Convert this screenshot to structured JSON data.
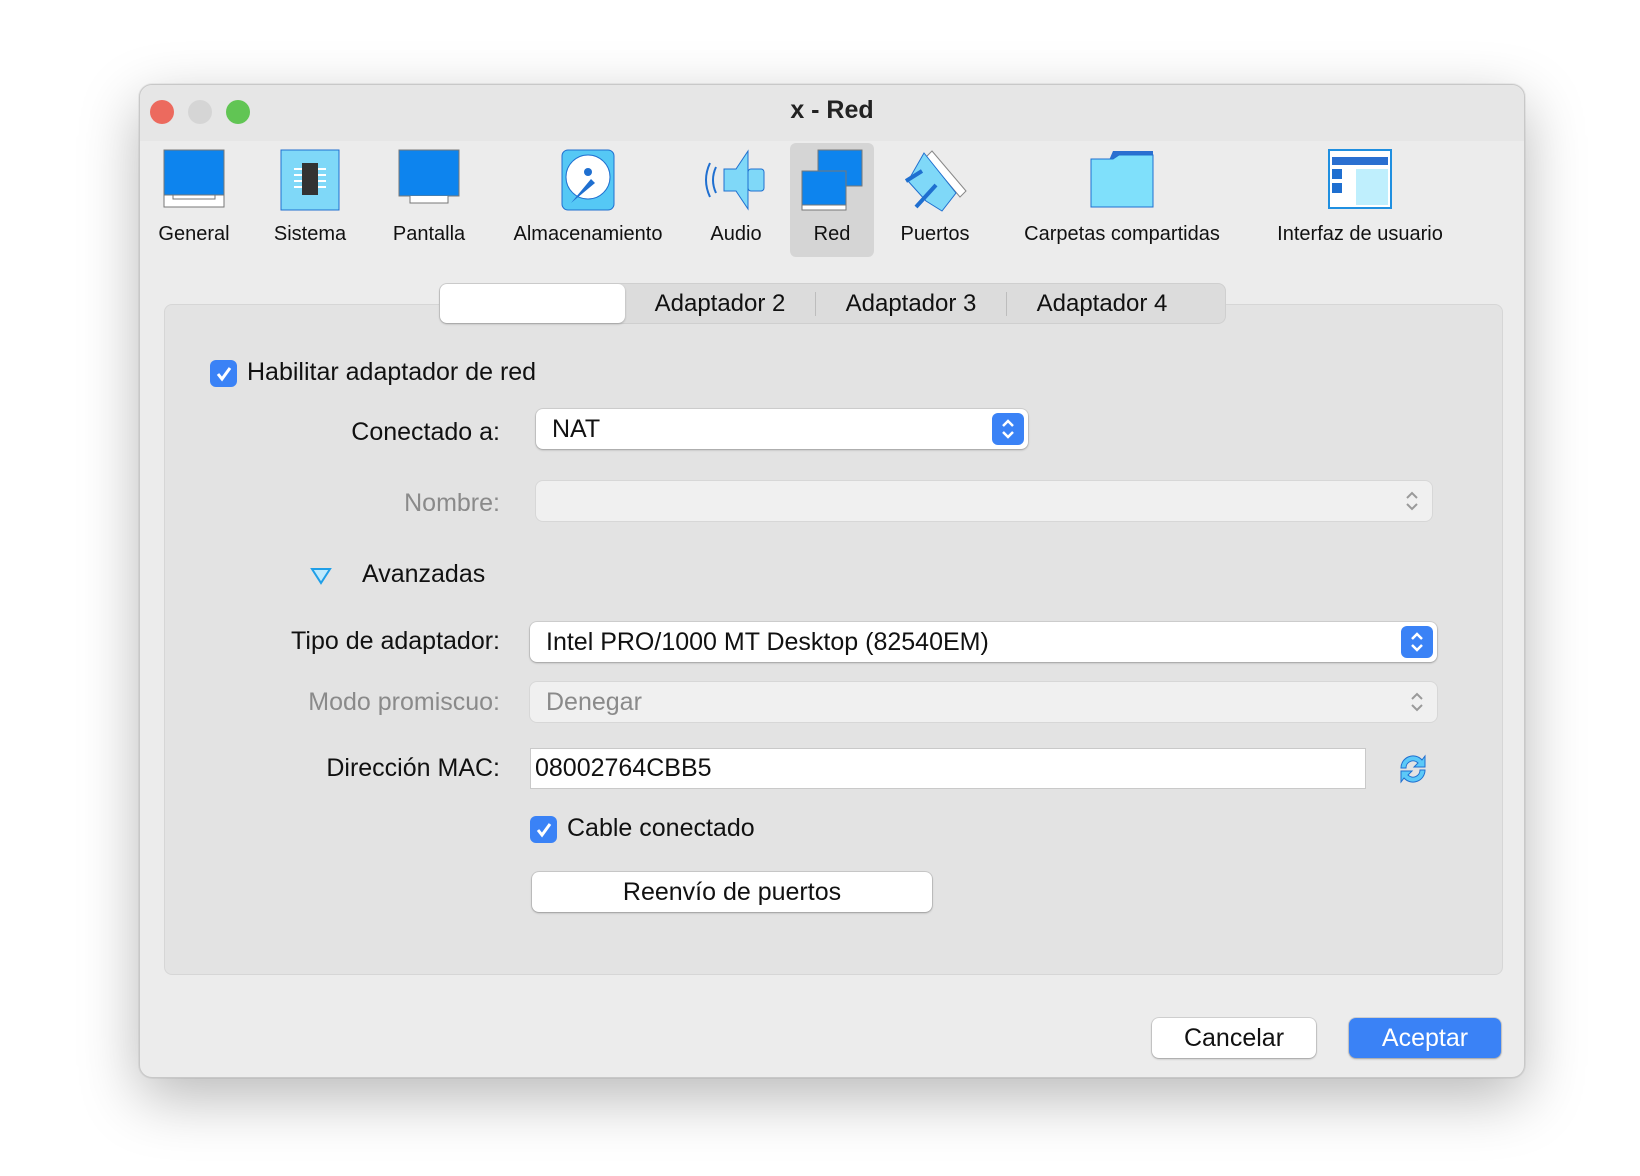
{
  "window": {
    "title": "x - Red"
  },
  "toolbar": {
    "items": [
      {
        "label": "General",
        "icon": "monitor-icon"
      },
      {
        "label": "Sistema",
        "icon": "chip-icon"
      },
      {
        "label": "Pantalla",
        "icon": "display-icon"
      },
      {
        "label": "Almacenamiento",
        "icon": "disk-icon"
      },
      {
        "label": "Audio",
        "icon": "speaker-icon"
      },
      {
        "label": "Red",
        "icon": "network-icon",
        "selected": true
      },
      {
        "label": "Puertos",
        "icon": "port-icon"
      },
      {
        "label": "Carpetas compartidas",
        "icon": "folder-icon"
      },
      {
        "label": "Interfaz de usuario",
        "icon": "ui-window-icon"
      }
    ]
  },
  "tabs": [
    {
      "label": "",
      "selected": true
    },
    {
      "label": "Adaptador 2"
    },
    {
      "label": "Adaptador 3"
    },
    {
      "label": "Adaptador 4"
    }
  ],
  "form": {
    "enable_label": "Habilitar adaptador de red",
    "enable_checked": true,
    "attached_label": "Conectado a:",
    "attached_value": "NAT",
    "name_label": "Nombre:",
    "name_value": "",
    "advanced_label": "Avanzadas",
    "adapter_type_label": "Tipo de adaptador:",
    "adapter_type_value": "Intel PRO/1000 MT Desktop (82540EM)",
    "promisc_label": "Modo promiscuo:",
    "promisc_value": "Denegar",
    "mac_label": "Dirección MAC:",
    "mac_value": "08002764CBB5",
    "cable_label": "Cable conectado",
    "cable_checked": true,
    "port_forward_label": "Reenvío de puertos"
  },
  "footer": {
    "cancel": "Cancelar",
    "ok": "Aceptar"
  },
  "colors": {
    "accent": "#3a82f6",
    "close": "#ec6a5e",
    "minimize": "#d5d5d5",
    "zoom": "#61c554"
  }
}
